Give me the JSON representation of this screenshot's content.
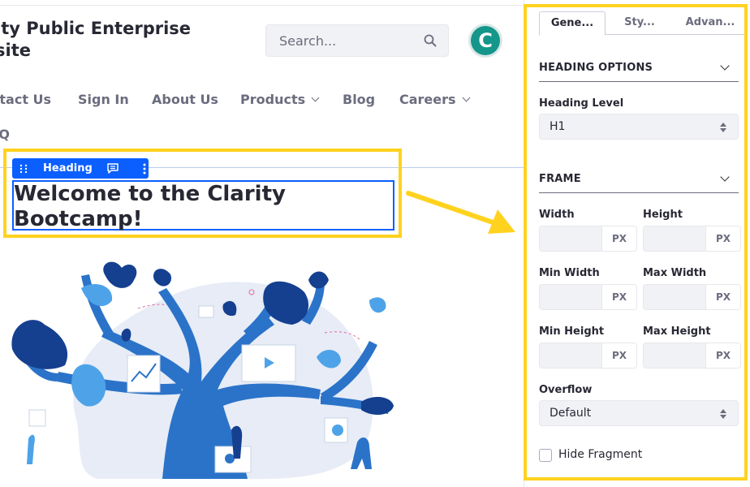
{
  "site": {
    "title_line1": "ity Public Enterprise",
    "title_line2": "site",
    "search_placeholder": "Search...",
    "avatar_letter": "C"
  },
  "nav": {
    "items": [
      {
        "label": "ntact Us"
      },
      {
        "label": "Sign In"
      },
      {
        "label": "About Us"
      },
      {
        "label": "Products",
        "has_dropdown": true
      },
      {
        "label": "Blog"
      },
      {
        "label": "Careers",
        "has_dropdown": true
      }
    ],
    "faq_label": "AQ"
  },
  "fragment": {
    "toolbar_label": "Heading",
    "heading_text": "Welcome to the Clarity Bootcamp!"
  },
  "panel": {
    "tabs": [
      {
        "label": "Gene...",
        "active": true
      },
      {
        "label": "Sty...",
        "active": false
      },
      {
        "label": "Advan...",
        "active": false
      }
    ],
    "heading_options": {
      "title": "HEADING OPTIONS",
      "level_label": "Heading Level",
      "level_value": "H1"
    },
    "frame": {
      "title": "FRAME",
      "width_label": "Width",
      "height_label": "Height",
      "min_width_label": "Min Width",
      "max_width_label": "Max Width",
      "min_height_label": "Min Height",
      "max_height_label": "Max Height",
      "unit": "PX",
      "overflow_label": "Overflow",
      "overflow_value": "Default"
    },
    "hide_fragment_label": "Hide Fragment"
  },
  "colors": {
    "accent": "#0b5fff",
    "annotation": "#ffd21f",
    "avatar": "#14968a"
  }
}
